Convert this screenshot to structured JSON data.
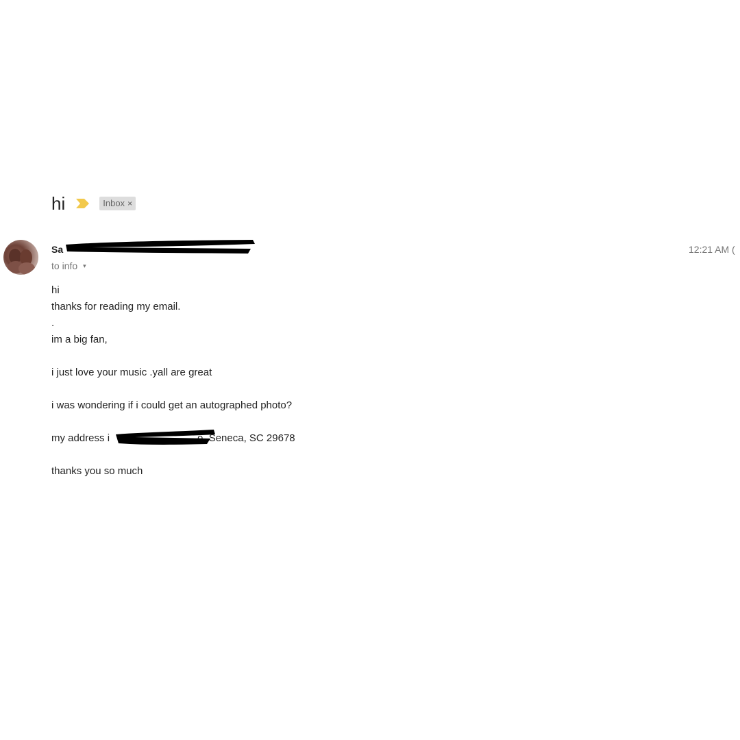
{
  "email": {
    "subject": "hi",
    "importance_icon": "importance-marker-icon",
    "label": "Inbox",
    "label_remove": "×",
    "sender_visible_prefix": "Sa",
    "to_line": "to info",
    "to_caret": "▾",
    "timestamp": "12:21 AM (",
    "body": {
      "line1": "hi",
      "line2": "thanks for reading my email.",
      "line3": ".",
      "line4": "im a big fan,",
      "line5": "i just love your music .yall are great",
      "line6": "i was wondering if i could get an autographed photo?",
      "line7_prefix": "my address i",
      "line7_suffix": "o, Seneca, SC 29678",
      "line8": "thanks you so much"
    }
  },
  "colors": {
    "importance": "#f2c94c",
    "label_bg": "#dddddd",
    "redaction": "#000000",
    "meta_text": "#777777"
  }
}
